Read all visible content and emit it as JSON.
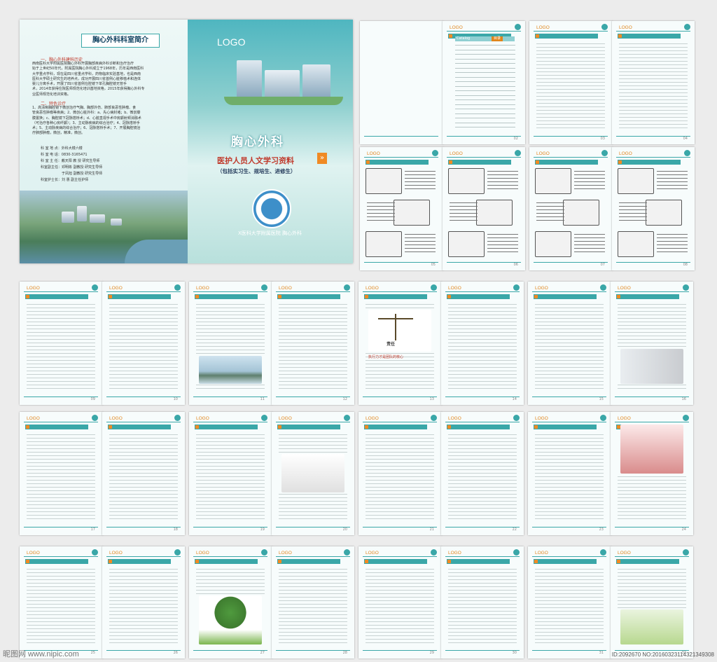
{
  "cover": {
    "title_box": "胸心外科科室简介",
    "section1": "一、胸心外科建科历史",
    "section1_text": [
      "西南医科大学附属医院胸心外科开展胸部疾病外科诊断和治疗治疗",
      "始于上世纪50年代，附属医院胸心外科成立于1968年，历年是西南医科",
      "大学重点学科，现在是四川省重点学科，药物临床实验基地，也是西南",
      "医科大学硕士研究生的培养点，成功开展四川省首例心脏移植术和连体",
      "婴儿分离手术，开展了四川省首例在腔镜下单孔胸腔镜无管手",
      "术，2014年获得住院医师规范化培训基地资格，2015年获得胸心外科专",
      "业医师规范化培训资格。"
    ],
    "section2": "二、特色诊疗",
    "section2_text": [
      "1、高清晰胸腔镜下微创治疗气胸、胸部外伤、肺部良恶性肿瘤、食",
      "管良恶性肿瘤等疾病；2、微创心脏外科：a、先心病封堵；b、微创瓣",
      "膜置换；c、胸腔镜下冠脉搭桥术；d、心脏直视手术中房颤射频消融术",
      "（可治疗各种心房纤颤）；3、主动脉疾病的综合治疗；4、冠脉搭桥手",
      "术；5、主动脉疾病的综合治疗；6、冠脉搭桥手术；7、开展胸腔镜治",
      "疗肺部肿瘤，微创，精准，微创。"
    ],
    "contact": [
      "科 室 地 点：外科大楼六楼",
      "科 室 电 话：0830-3165471",
      "科 室 主 任：戴天阳 教 授  研究生导师",
      "科室副主任：邓明彬 副教授  研究生导师",
      "             于凤旭 副教授  研究生导师",
      "科室护士长：刘 惠 副主任护师"
    ],
    "logo": "LOGO",
    "main_title": "胸心外科",
    "sub_title": "医护人员人文学习资料",
    "arrow": "»",
    "paren": "（包括实习生、规培生、进修生）",
    "footer": "X医科大学附属医院  胸心外科"
  },
  "pages": {
    "logo": "LOGO",
    "catalog_en": "Catalog",
    "catalog_cn": "目录",
    "zeren": "责任",
    "zeren_caption": "执行力才是团队的核心",
    "page_numbers": [
      "01",
      "02",
      "03",
      "04",
      "05",
      "06",
      "07",
      "08",
      "09",
      "10",
      "11",
      "12",
      "13",
      "14",
      "15",
      "16",
      "17",
      "18",
      "19",
      "20",
      "21",
      "22",
      "23",
      "24",
      "25",
      "26",
      "27",
      "28",
      "29",
      "30",
      "31",
      "32"
    ]
  },
  "watermark": {
    "left": "昵图网 www.nipic.com",
    "right": "ID:2092670 NO:20160323114321349308"
  },
  "colors": {
    "teal": "#3aa7a8",
    "orange": "#e0851b",
    "red": "#c0392b"
  }
}
